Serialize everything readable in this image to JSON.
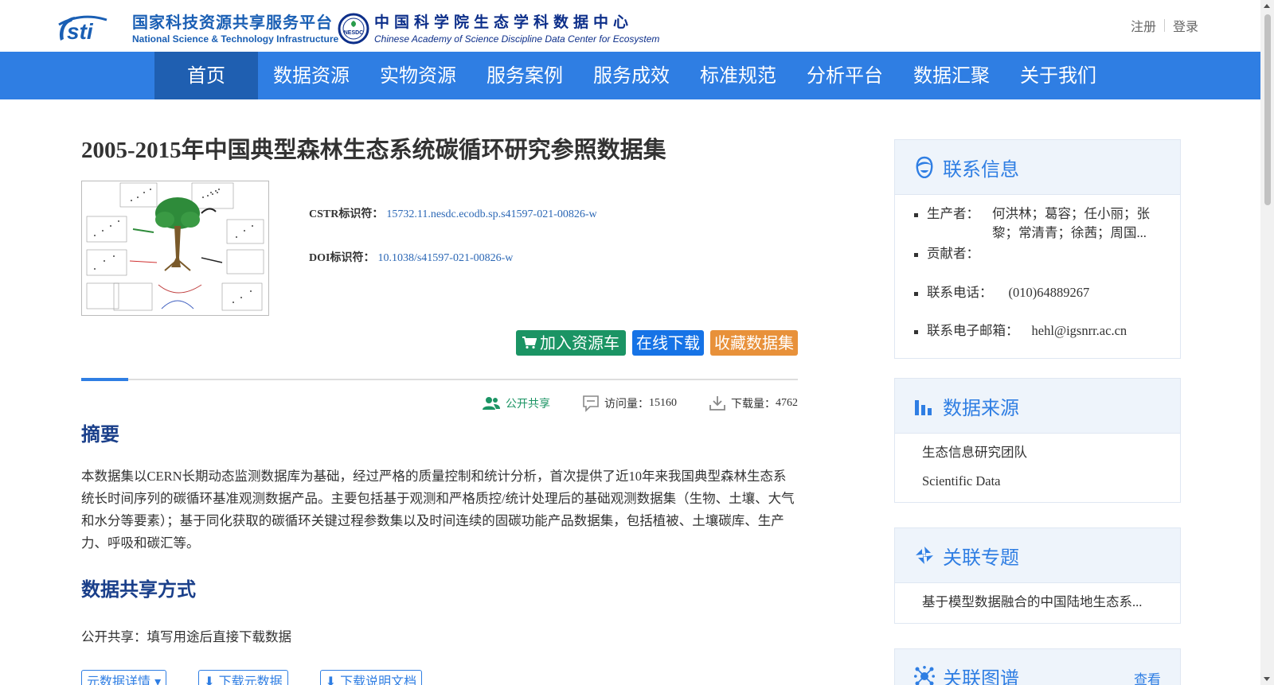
{
  "header": {
    "logo1": {
      "cn": "国家科技资源共享服务平台",
      "en": "National Science & Technology Infrastructure",
      "mark": "nsti"
    },
    "logo2": {
      "cn": "中国科学院生态学科数据中心",
      "en": "Chinese Academy of Science Discipline Data Center for Ecosystem",
      "seal": "NESDC"
    },
    "auth": {
      "register": "注册",
      "login": "登录"
    }
  },
  "nav": {
    "items": [
      {
        "label": "首页"
      },
      {
        "label": "数据资源"
      },
      {
        "label": "实物资源"
      },
      {
        "label": "服务案例"
      },
      {
        "label": "服务成效"
      },
      {
        "label": "标准规范"
      },
      {
        "label": "分析平台"
      },
      {
        "label": "数据汇聚"
      },
      {
        "label": "关于我们"
      }
    ]
  },
  "dataset": {
    "title": "2005-2015年中国典型森林生态系统碳循环研究参照数据集",
    "cstr_label": "CSTR标识符：",
    "cstr_value": "15732.11.nesdc.ecodb.sp.s41597-021-00826-w",
    "doi_label": "DOI标识符：",
    "doi_value": "10.1038/s41597-021-00826-w",
    "actions": {
      "cart": "加入资源车",
      "download": "在线下载",
      "favorite": "收藏数据集"
    },
    "stats": {
      "share": "公开共享",
      "visits_label": "访问量：",
      "visits": "15160",
      "downloads_label": "下载量：",
      "downloads": "4762"
    },
    "abstract_heading": "摘要",
    "abstract": "本数据集以CERN长期动态监测数据库为基础，经过严格的质量控制和统计分析，首次提供了近10年来我国典型森林生态系统长时间序列的碳循环基准观测数据产品。主要包括基于观测和严格质控/统计处理后的基础观测数据集（生物、土壤、大气和水分等要素）；基于同化获取的碳循环关键过程参数集以及时间连续的固碳功能产品数据集，包括植被、土壤碳库、生产力、呼吸和碳汇等。",
    "share_heading": "数据共享方式",
    "share_way": "公开共享：填写用途后直接下载数据",
    "small_buttons": {
      "meta": "元数据详情",
      "dl_meta": "下载元数据",
      "dl_doc": "下载说明文档"
    }
  },
  "sidebar": {
    "contact": {
      "title": "联系信息",
      "producer_label": "生产者：",
      "producer": "何洪林；葛容；任小丽；张黎；常清青；徐茜；周国...",
      "contributor_label": "贡献者：",
      "contributor": "",
      "phone_label": "联系电话：",
      "phone": "(010)64889267",
      "email_label": "联系电子邮箱：",
      "email": "hehl@igsnrr.ac.cn"
    },
    "source": {
      "title": "数据来源",
      "items": [
        "生态信息研究团队",
        "Scientific Data"
      ]
    },
    "topic": {
      "title": "关联专题",
      "items": [
        "基于模型数据融合的中国陆地生态系..."
      ]
    },
    "graph": {
      "title": "关联图谱",
      "more": "查看"
    }
  },
  "colors": {
    "nav": "#2f7ee3",
    "nav_active": "#1f5fb1",
    "cart": "#1b9464",
    "download": "#1673e6",
    "favorite": "#e8913a"
  }
}
